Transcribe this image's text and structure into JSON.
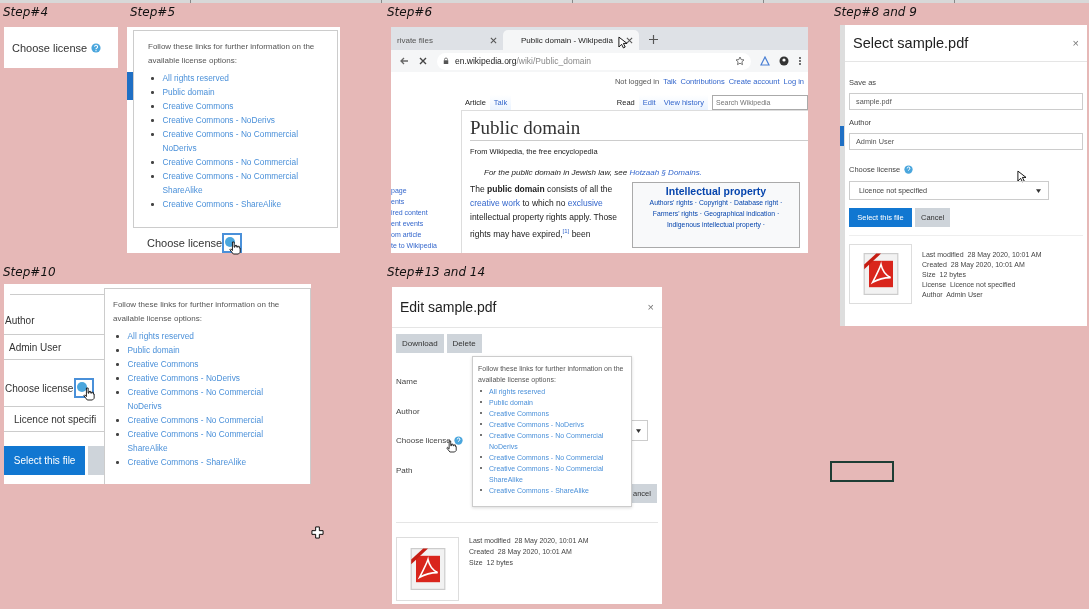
{
  "step4": {
    "heading": "Step#4",
    "label": "Choose license"
  },
  "step5": {
    "heading": "Step#5",
    "popover": {
      "intro": "Follow these links for further information on the available license options:",
      "links": [
        "All rights reserved",
        "Public domain",
        "Creative Commons",
        "Creative Commons - NoDerivs",
        "Creative Commons - No Commercial NoDerivs",
        "Creative Commons - No Commercial",
        "Creative Commons - No Commercial ShareAlike",
        "Creative Commons - ShareAlike"
      ]
    },
    "label": "Choose license"
  },
  "step6": {
    "heading": "Step#6",
    "tabs": [
      {
        "label": "rivate files",
        "selected": false
      },
      {
        "label": "Public domain - Wikipedia",
        "selected": true
      }
    ],
    "url_host": "en.wikipedia.org",
    "url_path": "/wiki/Public_domain",
    "user_links": [
      {
        "text": "Not logged in",
        "link": false
      },
      {
        "text": "Talk",
        "link": true
      },
      {
        "text": "Contributions",
        "link": true
      },
      {
        "text": "Create account",
        "link": true
      },
      {
        "text": "Log in",
        "link": true
      }
    ],
    "page_tabs": [
      {
        "label": "Article",
        "selected": true
      },
      {
        "label": "Talk",
        "selected": false
      }
    ],
    "view_tabs": [
      {
        "label": "Read",
        "selected": true
      },
      {
        "label": "Edit",
        "selected": false
      },
      {
        "label": "View history",
        "selected": false
      }
    ],
    "search_placeholder": "Search Wikipedia",
    "sidebar_links": [
      "page",
      "ents",
      "ired content",
      "ent events",
      "om article",
      "te to Wikipedia"
    ],
    "title": "Public domain",
    "tagline": "From Wikipedia, the free encyclopedia",
    "hatnote": [
      {
        "text": "For the public domain in Jewish law, see ",
        "link": false
      },
      {
        "text": "Hotzaah § Domains.",
        "link": true
      }
    ],
    "paragraph": [
      {
        "text": "The **public domain** consists of all the ",
        "link": false
      },
      {
        "text": "creative work",
        "link": true
      },
      {
        "text": " to which no ",
        "link": false
      },
      {
        "text": "exclusive",
        "link": true
      },
      {
        "text": " intellectual property rights apply. Those rights may have expired,$^{[1]}$ been",
        "link": false
      }
    ],
    "infobox": {
      "title": "Intellectual property",
      "lines": [
        "Authors' rights · Copyright · Database right ·",
        "Farmers' rights · Geographical indication ·",
        "Indigenous intellectual property ·"
      ]
    }
  },
  "step8": {
    "heading": "Step#8 and 9",
    "title": "Select sample.pdf",
    "close": "×",
    "fields": [
      {
        "label": "Save as",
        "value": "sample.pdf"
      },
      {
        "label": "Author",
        "value": "Admin User"
      }
    ],
    "license_label": "Choose license",
    "license_value": "Licence not specified",
    "buttons": [
      {
        "label": "Select this file",
        "kind": "primary"
      },
      {
        "label": "Cancel",
        "kind": "secondary"
      }
    ],
    "meta": [
      "Last modified  28 May 2020, 10:01 AM",
      "Created  28 May 2020, 10:01 AM",
      "Size  12 bytes",
      "License  Licence not specified",
      "Author  Admin User"
    ]
  },
  "step10": {
    "heading": "Step#10",
    "author_label": "Author",
    "author_value": "Admin User",
    "license_label": "Choose license",
    "license_value": "Licence not specifi",
    "primary_button": "Select this file",
    "popover": {
      "intro": "Follow these links for further information on the available license options:",
      "links": [
        "All rights reserved",
        "Public domain",
        "Creative Commons",
        "Creative Commons - NoDerivs",
        "Creative Commons - No Commercial NoDerivs",
        "Creative Commons - No Commercial",
        "Creative Commons - No Commercial ShareAlike",
        "Creative Commons - ShareAlike"
      ]
    }
  },
  "step13": {
    "heading": "Step#13 and 14",
    "title": "Edit sample.pdf",
    "close": "×",
    "actions": [
      "Download",
      "Delete"
    ],
    "labels": [
      {
        "text": "Name",
        "help": false
      },
      {
        "text": "Author",
        "help": false
      },
      {
        "text": "Choose license",
        "help": true
      },
      {
        "text": "Path",
        "help": false
      }
    ],
    "cancel_partial": "ancel",
    "popover": {
      "intro": "Follow these links for further information on the available license options:",
      "links": [
        "All rights reserved",
        "Public domain",
        "Creative Commons",
        "Creative Commons - NoDerivs",
        "Creative Commons - No Commercial NoDerivs",
        "Creative Commons - No Commercial",
        "Creative Commons - No Commercial ShareAlike",
        "Creative Commons - ShareAlike"
      ]
    },
    "meta": [
      "Last modified  28 May 2020, 10:01 AM",
      "Created  28 May 2020, 10:01 AM",
      "Size  12 bytes"
    ]
  }
}
